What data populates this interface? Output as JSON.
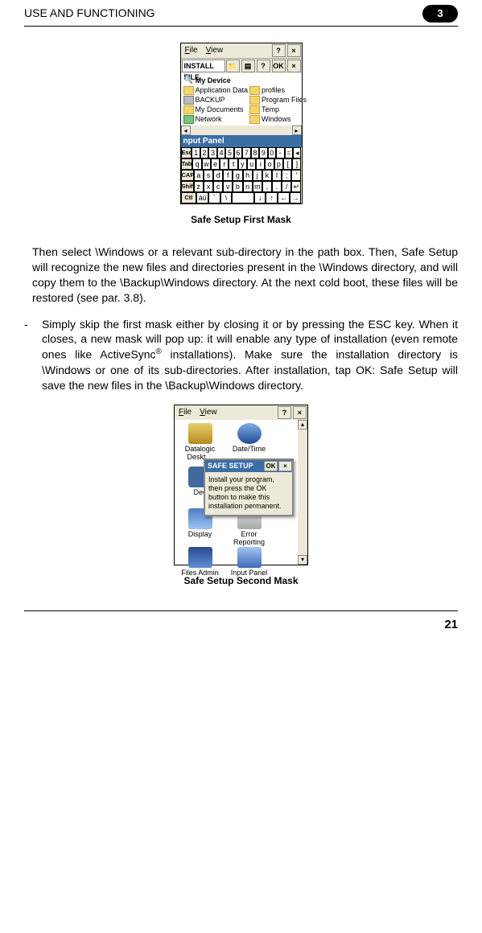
{
  "header": {
    "title": "USE AND FUNCTIONING",
    "chapter": "3"
  },
  "figure1": {
    "menu": {
      "file": "File",
      "view": "View",
      "help": "?",
      "close": "×"
    },
    "addressbar": {
      "label": "INSTALL FILE",
      "qmark": "?",
      "ok": "OK",
      "close": "×"
    },
    "location": "My Device",
    "left_col": [
      "Application Data",
      "BACKUP",
      "My Documents",
      "Network"
    ],
    "right_col": [
      "profiles",
      "Program Files",
      "Temp",
      "Windows"
    ],
    "panel_hdr": "nput Panel",
    "kbd_rows": {
      "r1": [
        "Esc",
        "1",
        "2",
        "3",
        "4",
        "5",
        "6",
        "7",
        "8",
        "9",
        "0",
        "-",
        "=",
        "◂"
      ],
      "r2": [
        "Tab",
        "q",
        "w",
        "e",
        "r",
        "t",
        "y",
        "u",
        "i",
        "o",
        "p",
        "[",
        "]"
      ],
      "r3": [
        "CAP",
        "a",
        "s",
        "d",
        "f",
        "g",
        "h",
        "j",
        "k",
        "l",
        ";",
        "'"
      ],
      "r4": [
        "Shift",
        "z",
        "x",
        "c",
        "v",
        "b",
        "n",
        "m",
        ",",
        ".",
        "/",
        "↵"
      ],
      "r5": [
        "Ctl",
        "áü",
        "`",
        "\\"
      ]
    },
    "caption": "Safe Setup First Mask"
  },
  "para1": "Then select \\Windows or a relevant sub-directory in the path box. Then, Safe Setup will recognize the new files and directories present in the \\Windows directory, and will copy them to the \\Backup\\Windows directory. At the next cold boot, these files will be restored (see par. 3.8).",
  "bullet": {
    "dash": "-",
    "text_a": "Simply skip the first mask either by closing it or by pressing the ESC key. When it closes, a new mask will pop up: it will enable any type of installation (even remote ones like ActiveSync",
    "sup": "®",
    "text_b": " installations). Make sure the installation directory is \\Windows or one of its sub-directories. After installation, tap OK: Safe Setup will save the new files in the \\Backup\\Windows directory."
  },
  "figure2": {
    "menu": {
      "file": "File",
      "view": "View",
      "help": "?",
      "close": "×"
    },
    "icons": [
      {
        "label": "Datalogic Deskt…"
      },
      {
        "label": "Date/Time"
      },
      {
        "label": "Dec"
      },
      {
        "label": "Display"
      },
      {
        "label": "Error Reporting"
      },
      {
        "label": "Files Admin"
      },
      {
        "label": "Input Panel"
      }
    ],
    "dialog": {
      "title": "SAFE SETUP",
      "ok": "OK",
      "close": "×",
      "body": "Install your program, then press the OK button to make this installation permanent."
    },
    "caption": "Safe Setup Second Mask"
  },
  "page_num": "21"
}
